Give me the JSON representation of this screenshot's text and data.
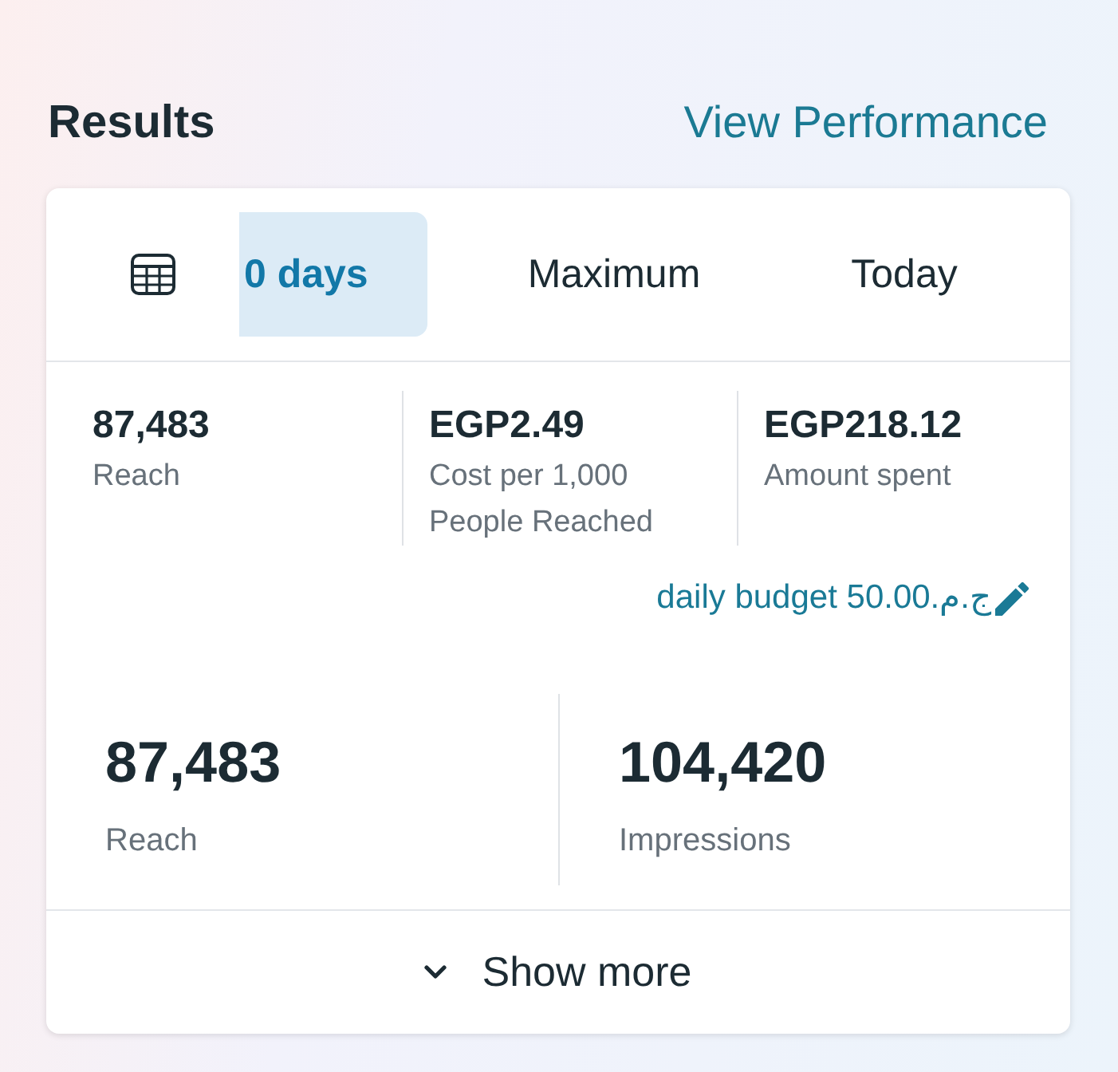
{
  "header": {
    "title": "Results",
    "link": "View Performance"
  },
  "period_tabs": [
    {
      "label": "0 days",
      "selected": true
    },
    {
      "label": "Maximum",
      "selected": false
    },
    {
      "label": "Today",
      "selected": false
    }
  ],
  "summary_stats": [
    {
      "value": "87,483",
      "label": "Reach"
    },
    {
      "value": "EGP2.49",
      "label": "Cost per 1,000 People Reached"
    },
    {
      "value": "EGP218.12",
      "label": "Amount spent"
    }
  ],
  "budget": {
    "text": "daily budget 50.00.ج.م"
  },
  "highlights": [
    {
      "value": "87,483",
      "label": "Reach"
    },
    {
      "value": "104,420",
      "label": "Impressions"
    }
  ],
  "show_more": {
    "label": "Show more",
    "expanded": false
  }
}
